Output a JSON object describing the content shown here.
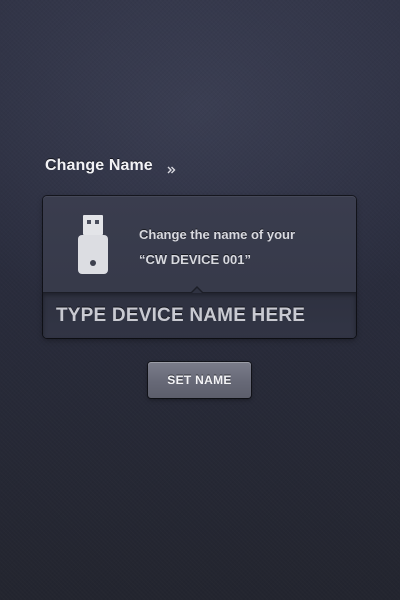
{
  "section": {
    "title": "Change Name",
    "arrow_icon": "double-arrow-right-icon"
  },
  "card": {
    "device_icon": "usb-drive-icon",
    "message_line1": "Change the name of your",
    "message_line2": "“CW DEVICE 001”"
  },
  "input": {
    "placeholder": "TYPE DEVICE NAME HERE",
    "value": ""
  },
  "button": {
    "label": "SET NAME"
  },
  "colors": {
    "background": "#2a2d3e",
    "card": "#383b4c",
    "button": "#6b6d7b",
    "text": "#f2f2f5"
  }
}
